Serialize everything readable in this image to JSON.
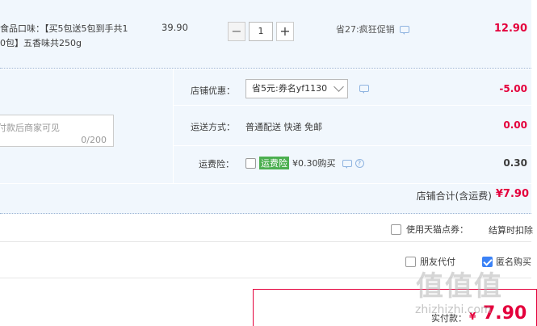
{
  "item": {
    "desc_line1": "食品口味：【买5包送5包到手共1",
    "desc_line2": "0包】五香味共250g",
    "unit_price": "39.90",
    "qty_minus": "−",
    "qty_value": "1",
    "qty_plus": "+",
    "promo_text": "省27:疯狂促销",
    "total": "12.90"
  },
  "message": {
    "placeholder": "付款后商家可见",
    "count": "0/200"
  },
  "shop": {
    "coupon_label": "店铺优惠：",
    "coupon_value": "省5元:券名yf1130",
    "coupon_amount": "-5.00",
    "shipping_label": "运送方式：",
    "shipping_value": "普通配送 快递 免邮",
    "shipping_amount": "0.00",
    "insurance_label": "运费险：",
    "insurance_tag": "运费险",
    "insurance_price": "¥0.30购买",
    "insurance_amount": "0.30",
    "total_label": "店铺合计(含运费)",
    "total_value": "¥7.90"
  },
  "points": {
    "label": "使用天猫点券：",
    "note": "结算时扣除"
  },
  "options": {
    "friend_pay": "朋友代付",
    "anonymous": "匿名购买"
  },
  "payment": {
    "label": "实付款：",
    "currency": "¥",
    "value": "7.90"
  },
  "watermark": {
    "glyphs": "值值值",
    "site": "zhizhizhi.com"
  },
  "colors": {
    "accent": "#e4003c",
    "row_bg": "#f1f7fd",
    "check_blue": "#3b82f6",
    "insurance_green": "#4caf50"
  }
}
